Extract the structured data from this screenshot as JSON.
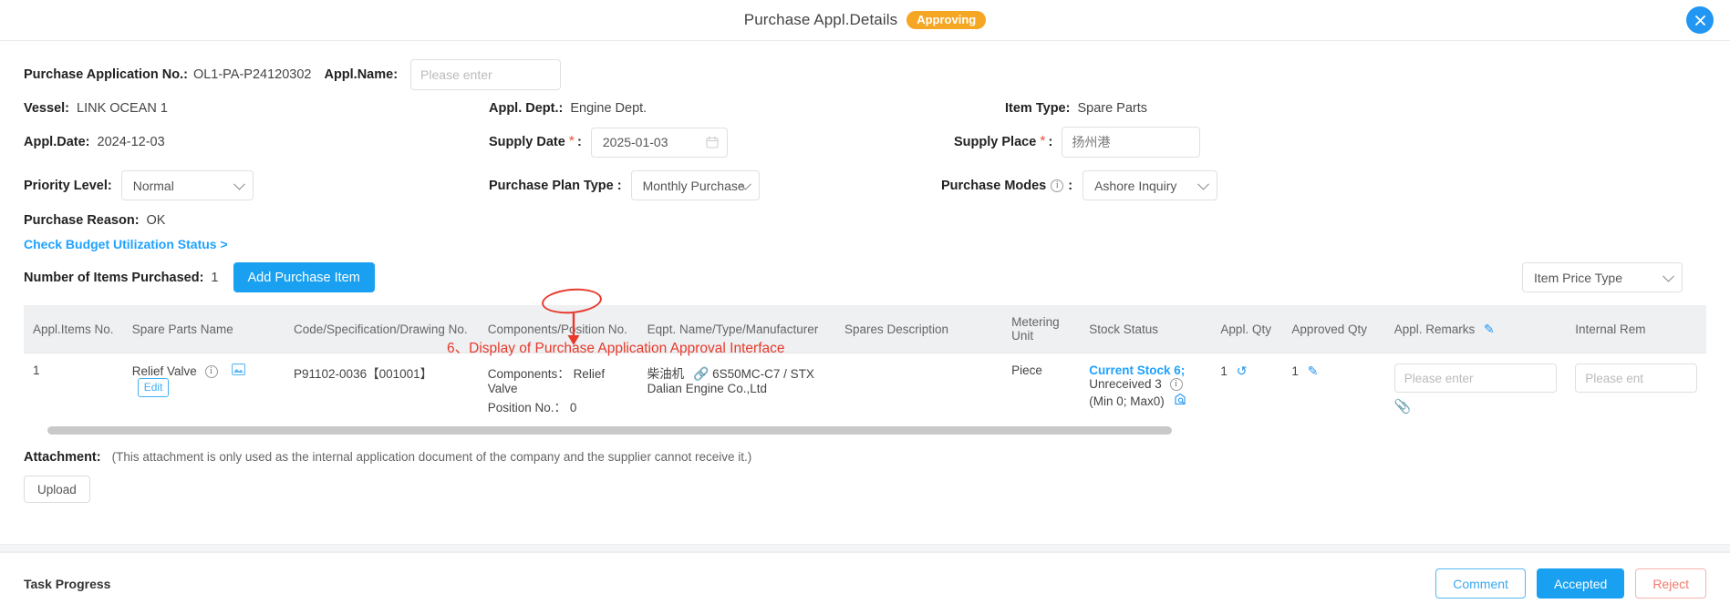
{
  "window": {
    "title": "Purchase Appl.Details",
    "status_badge": "Approving",
    "close_icon": "close-icon",
    "accent_color": "#19a0f0",
    "badge_color": "#f5a623"
  },
  "header": {
    "appl_no_label": "Purchase Application No.:",
    "appl_no_value": "OL1-PA-P24120302",
    "appl_name_label": "Appl.Name:",
    "appl_name_placeholder": "Please enter",
    "appl_name_value": "",
    "vessel_label": "Vessel:",
    "vessel_value": "LINK OCEAN 1",
    "appl_date_label": "Appl.Date:",
    "appl_date_value": "2024-12-03",
    "appl_dept_label": "Appl. Dept.:",
    "appl_dept_value": "Engine Dept.",
    "supply_date_label": "Supply Date",
    "supply_date_value": "2025-01-03",
    "item_type_label": "Item Type:",
    "item_type_value": "Spare Parts",
    "supply_place_label": "Supply Place",
    "supply_place_value": "扬州港",
    "priority_label": "Priority Level:",
    "priority_value": "Normal",
    "plan_type_label": "Purchase Plan Type :",
    "plan_type_value": "Monthly Purchase",
    "purchase_modes_label": "Purchase Modes",
    "purchase_modes_value": "Ashore Inquiry",
    "colon": ":",
    "required_mark": "*"
  },
  "reason": {
    "label": "Purchase Reason:",
    "value": "OK",
    "budget_link": "Check Budget Utilization Status >",
    "items_label": "Number of Items Purchased:",
    "items_count": "1",
    "add_button": "Add Purchase Item",
    "price_type_value": "Item Price Type"
  },
  "table": {
    "columns": [
      "Appl.Items No.",
      "Spare Parts Name",
      "Code/Specification/Drawing No.",
      "Components/Position No.",
      "Eqpt. Name/Type/Manufacturer",
      "Spares Description",
      "Metering Unit",
      "Stock Status",
      "Appl. Qty",
      "Approved Qty",
      "Appl. Remarks",
      "Internal Rem"
    ],
    "rows": [
      {
        "no": "1",
        "spare_parts_name": "Relief Valve",
        "edit_label": "Edit",
        "code": "P91102-0036【001001】",
        "components_label": "Components：",
        "components_value": "Relief Valve",
        "position_label": "Position No.：",
        "position_value": "0",
        "eqpt_name": "柴油机",
        "eqpt_type": "6S50MC-C7 / STX Dalian Engine Co.,Ltd",
        "spares_description": "",
        "metering_unit": "Piece",
        "stock_current": "Current Stock 6;",
        "stock_unreceived": "Unreceived 3",
        "stock_minmax": "(Min 0; Max0)",
        "appl_qty": "1",
        "approved_qty": "1",
        "appl_remarks_placeholder": "Please enter",
        "internal_remarks_placeholder": "Please ent"
      }
    ]
  },
  "annotation": {
    "text": "6、Display of Purchase Application Approval Interface",
    "color": "#e8392c"
  },
  "attachment": {
    "label": "Attachment:",
    "note": "(This attachment is only used as the internal application document of the company and the supplier cannot receive it.)",
    "upload_button": "Upload"
  },
  "footer": {
    "task_progress": "Task Progress",
    "comment_button": "Comment",
    "accept_button": "Accepted",
    "reject_button": "Reject"
  }
}
